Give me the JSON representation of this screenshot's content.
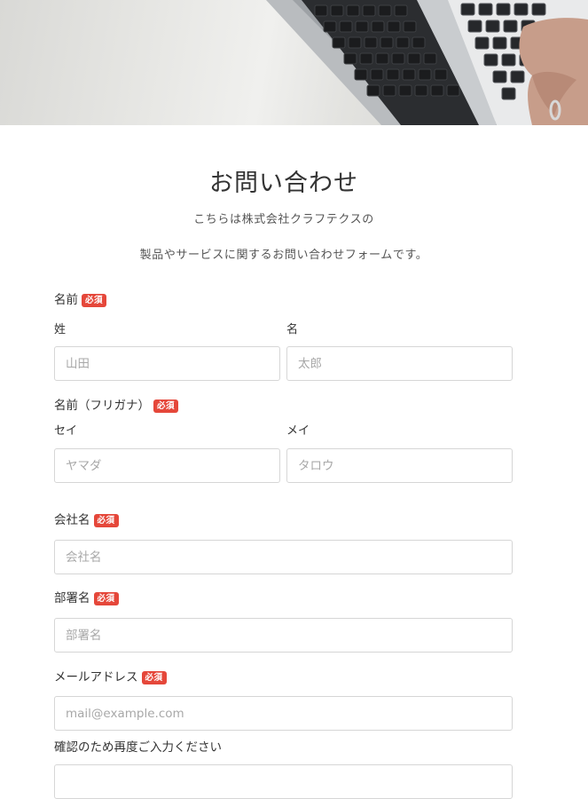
{
  "header": {
    "title": "お問い合わせ",
    "intro_line1": "こちらは株式会社クラフテクスの",
    "intro_line2": "製品やサービスに関するお問い合わせフォームです。"
  },
  "required_badge": "必須",
  "form": {
    "name": {
      "label": "名前",
      "last_label": "姓",
      "last_placeholder": "山田",
      "first_label": "名",
      "first_placeholder": "太郎"
    },
    "name_kana": {
      "label": "名前（フリガナ）",
      "last_label": "セイ",
      "last_placeholder": "ヤマダ",
      "first_label": "メイ",
      "first_placeholder": "タロウ"
    },
    "company": {
      "label": "会社名",
      "placeholder": "会社名"
    },
    "department": {
      "label": "部署名",
      "placeholder": "部署名"
    },
    "email": {
      "label": "メールアドレス",
      "placeholder": "mail@example.com"
    },
    "email_confirm": {
      "label": "確認のため再度ご入力ください",
      "placeholder": ""
    }
  },
  "colors": {
    "badge": "#e5473a",
    "border": "#d6d6d6",
    "placeholder": "#a8a8a8"
  }
}
